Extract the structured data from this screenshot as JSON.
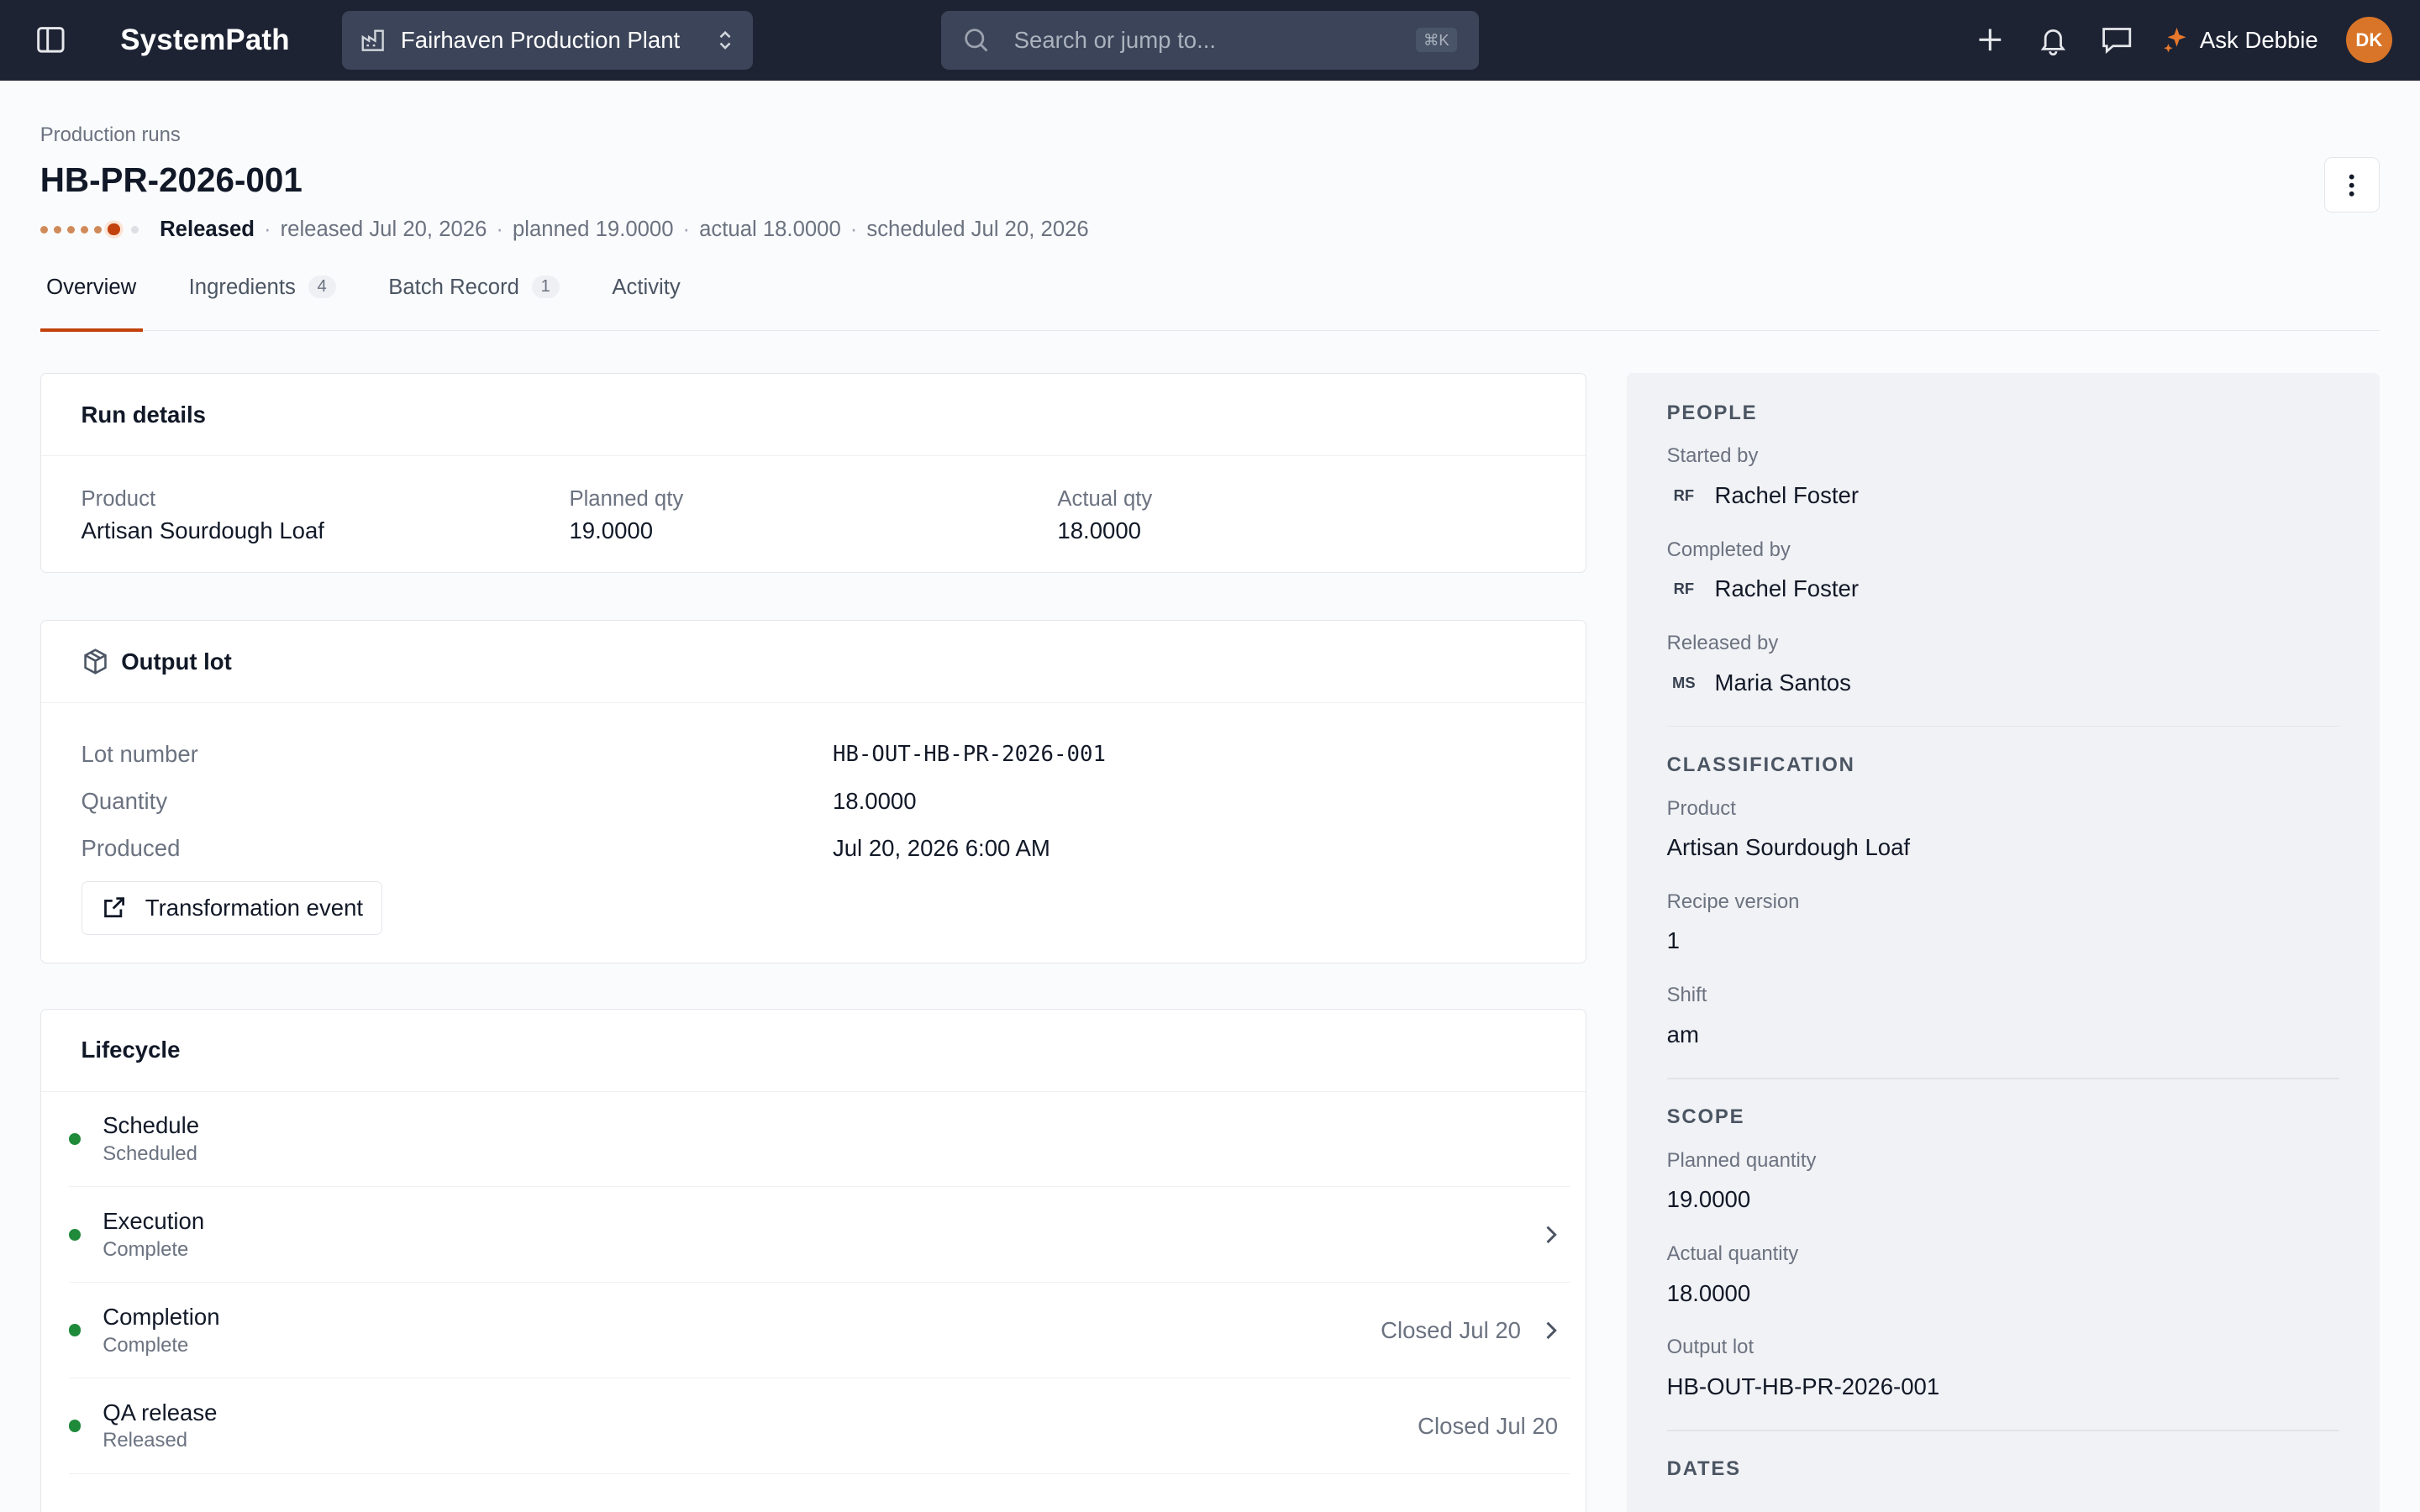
{
  "topbar": {
    "brand": "SystemPath",
    "plant": "Fairhaven Production Plant",
    "search_placeholder": "Search or jump to...",
    "search_shortcut": "⌘K",
    "ask_label": "Ask Debbie",
    "avatar_initials": "DK",
    "accent": "#d97528"
  },
  "header": {
    "breadcrumb": "Production runs",
    "title": "HB-PR-2026-001",
    "status": "Released",
    "meta": [
      "released Jul 20, 2026",
      "planned 19.0000",
      "actual 18.0000",
      "scheduled Jul 20, 2026"
    ],
    "sep": "·",
    "progress_step": 6,
    "progress_total": 7
  },
  "tabs": [
    {
      "label": "Overview",
      "count": ""
    },
    {
      "label": "Ingredients",
      "count": "4"
    },
    {
      "label": "Batch Record",
      "count": "1"
    },
    {
      "label": "Activity",
      "count": ""
    }
  ],
  "run_details": {
    "heading": "Run details",
    "product_label": "Product",
    "product_value": "Artisan Sourdough Loaf",
    "planned_label": "Planned qty",
    "planned_value": "19.0000",
    "actual_label": "Actual qty",
    "actual_value": "18.0000"
  },
  "output_lot": {
    "heading": "Output lot",
    "lot_label": "Lot number",
    "lot_value": "HB-OUT-HB-PR-2026-001",
    "qty_label": "Quantity",
    "qty_value": "18.0000",
    "produced_label": "Produced",
    "produced_value": "Jul 20, 2026 6:00 AM",
    "link_label": "Transformation event"
  },
  "lifecycle": {
    "heading": "Lifecycle",
    "status_color": "#1f8a3a",
    "rows": [
      {
        "title": "Schedule",
        "status": "Scheduled",
        "right": ""
      },
      {
        "title": "Execution",
        "status": "Complete",
        "right": ""
      },
      {
        "title": "Completion",
        "status": "Complete",
        "right": "Closed Jul 20"
      },
      {
        "title": "QA release",
        "status": "Released",
        "right": "Closed Jul 20"
      }
    ]
  },
  "side": {
    "people_title": "PEOPLE",
    "started_label": "Started by",
    "started_initials": "RF",
    "started_name": "Rachel Foster",
    "completed_label": "Completed by",
    "completed_initials": "RF",
    "completed_name": "Rachel Foster",
    "released_label": "Released by",
    "released_initials": "MS",
    "released_name": "Maria Santos",
    "class_title": "CLASSIFICATION",
    "product_label": "Product",
    "product_value": "Artisan Sourdough Loaf",
    "recipe_label": "Recipe version",
    "recipe_value": "1",
    "shift_label": "Shift",
    "shift_value": "am",
    "scope_title": "SCOPE",
    "planned_label": "Planned quantity",
    "planned_value": "19.0000",
    "actual_label": "Actual quantity",
    "actual_value": "18.0000",
    "lot_label": "Output lot",
    "lot_value": "HB-OUT-HB-PR-2026-001",
    "dates_title": "DATES"
  }
}
